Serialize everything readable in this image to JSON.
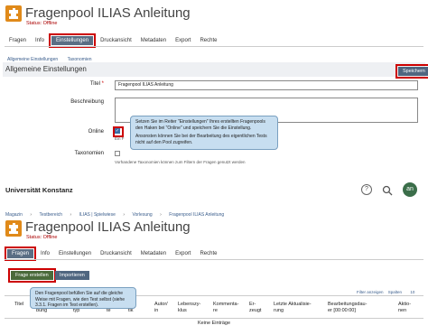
{
  "top": {
    "title": "Fragenpool ILIAS Anleitung",
    "status": "Status: Offline",
    "tabs": [
      "Fragen",
      "Info",
      "Einstellungen",
      "Druckansicht",
      "Metadaten",
      "Export",
      "Rechte"
    ],
    "sublinks": [
      "Allgemeine Einstellungen",
      "Taxonomien"
    ],
    "section_title": "Allgemeine Einstellungen",
    "save_label": "Speichern",
    "title_label": "Titel",
    "title_value": "Fragenpool ILIAS Anleitung",
    "description_label": "Beschreibung",
    "online_label": "Online",
    "online_hint": "Ein F",
    "taxonomies_label": "Taxonomien",
    "taxonomies_hint": "Vorhandene Taxonomien können zum Filtern der Fragen genutzt werden",
    "tooltip_line1": "Setzen Sie im Reiter \"Einstellungen\" Ihres erstellten Fragenpools den Haken bei \"Online\" und speichern Sie die Einstellung.",
    "tooltip_line2": "Ansonsten können Sie bei der Bearbeitung des eigentlichen Tests nicht auf den Pool zugreifen."
  },
  "bottom": {
    "org": "Universität Konstanz",
    "avatar": "an",
    "breadcrumbs": [
      "Magazin",
      "Testbereich",
      "ILIAS | Spielwiese",
      "Vorlesung",
      "Fragenpool ILIAS Anleitung"
    ],
    "title": "Fragenpool ILIAS Anleitung",
    "status": "Status: Offline",
    "tabs": [
      "Fragen",
      "Info",
      "Einstellungen",
      "Druckansicht",
      "Metadaten",
      "Export",
      "Rechte"
    ],
    "create_label": "Frage erstellen",
    "import_label": "Importieren",
    "filter_text": "Filter anzeigen",
    "columns_text": "Spalten",
    "count_text": "10",
    "tooltip": "Den Fragenpool befüllen Sie auf die gleiche Weise mit Fragen, wie den Test selbst (siehe 3.3.1. Fragen im Test erstellen).",
    "col_titel": "Titel",
    "col_b": "bung",
    "col_c": "typ",
    "col_d": "te",
    "col_e": "tik",
    "col_autor": "Autor/\nin",
    "col_lebens": "Lebenszy-\nklus",
    "col_komm": "Kommenta-\nre",
    "col_erz": "Er-\nzeugt",
    "col_letzte": "Letzte Aktualisie-\nrung",
    "col_bearb": "Bearbeitungsdau-\ner [00:00:00]",
    "col_aktion": "Aktio-\nnen",
    "empty": "Keine Einträge"
  }
}
